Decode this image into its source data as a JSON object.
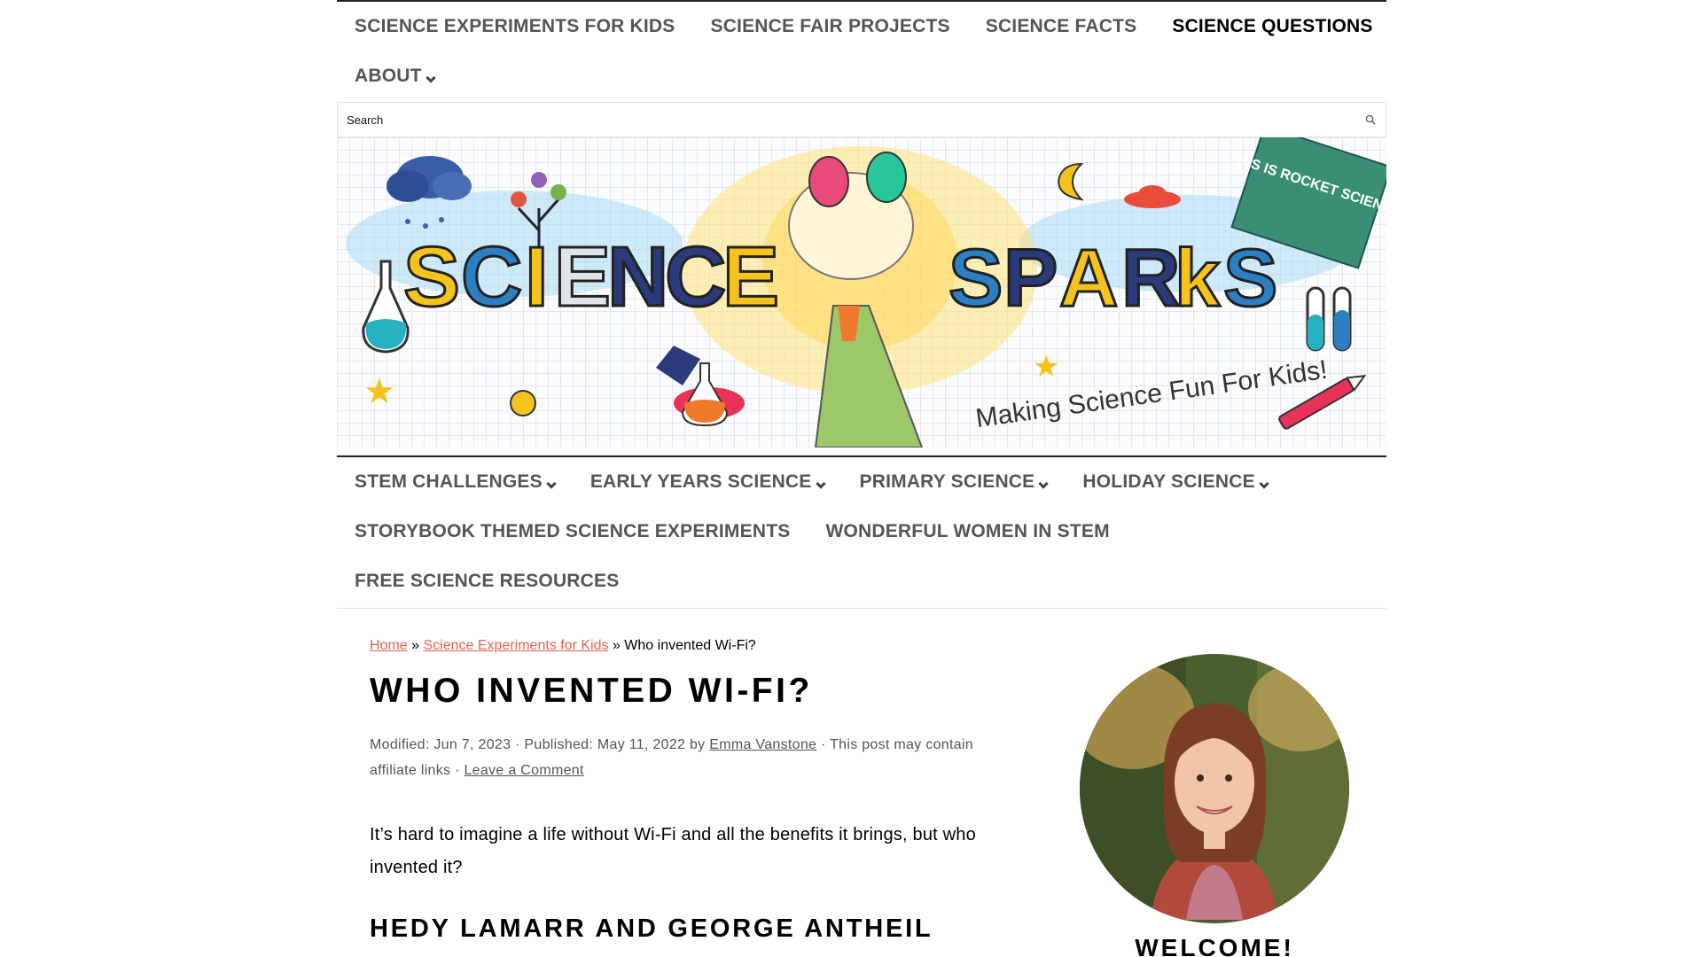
{
  "top_nav": {
    "row1": [
      "SCIENCE EXPERIMENTS FOR KIDS",
      "SCIENCE FAIR PROJECTS",
      "SCIENCE FACTS",
      "SCIENCE QUESTIONS"
    ],
    "about": "ABOUT"
  },
  "search": {
    "placeholder": "Search"
  },
  "banner": {
    "logo_left": "SCIENCE",
    "logo_right": "SPARKS",
    "tagline": "Making Science Fun For Kids!",
    "book_title": "THIS IS ROCKET SCIENCE"
  },
  "secondary_nav": {
    "stem": "STEM CHALLENGES",
    "early": "EARLY YEARS SCIENCE",
    "primary": "PRIMARY SCIENCE",
    "holiday": "HOLIDAY SCIENCE",
    "storybook": "STORYBOOK THEMED SCIENCE EXPERIMENTS",
    "women": "WONDERFUL WOMEN IN STEM",
    "free": "FREE SCIENCE RESOURCES"
  },
  "breadcrumb": {
    "home": "Home",
    "sep": "»",
    "category": "Science Experiments for Kids",
    "current": "Who invented Wi-Fi?"
  },
  "post": {
    "title": "WHO INVENTED WI-FI?",
    "meta_prefix": "Modified: Jun 7, 2023 · Published: May 11, 2022 by ",
    "author": "Emma Vanstone",
    "meta_suffix": " · This post may contain affiliate links · ",
    "comment_link": "Leave a Comment",
    "intro": "It’s hard to imagine a life without Wi-Fi and all the benefits it brings, but who invented it?",
    "heading": "HEDY LAMARR AND GEORGE ANTHEIL"
  },
  "sidebar": {
    "welcome": "WELCOME!"
  },
  "colors": {
    "link": "#e8614d",
    "nav_text": "#555555",
    "accent_dark": "#222222"
  }
}
